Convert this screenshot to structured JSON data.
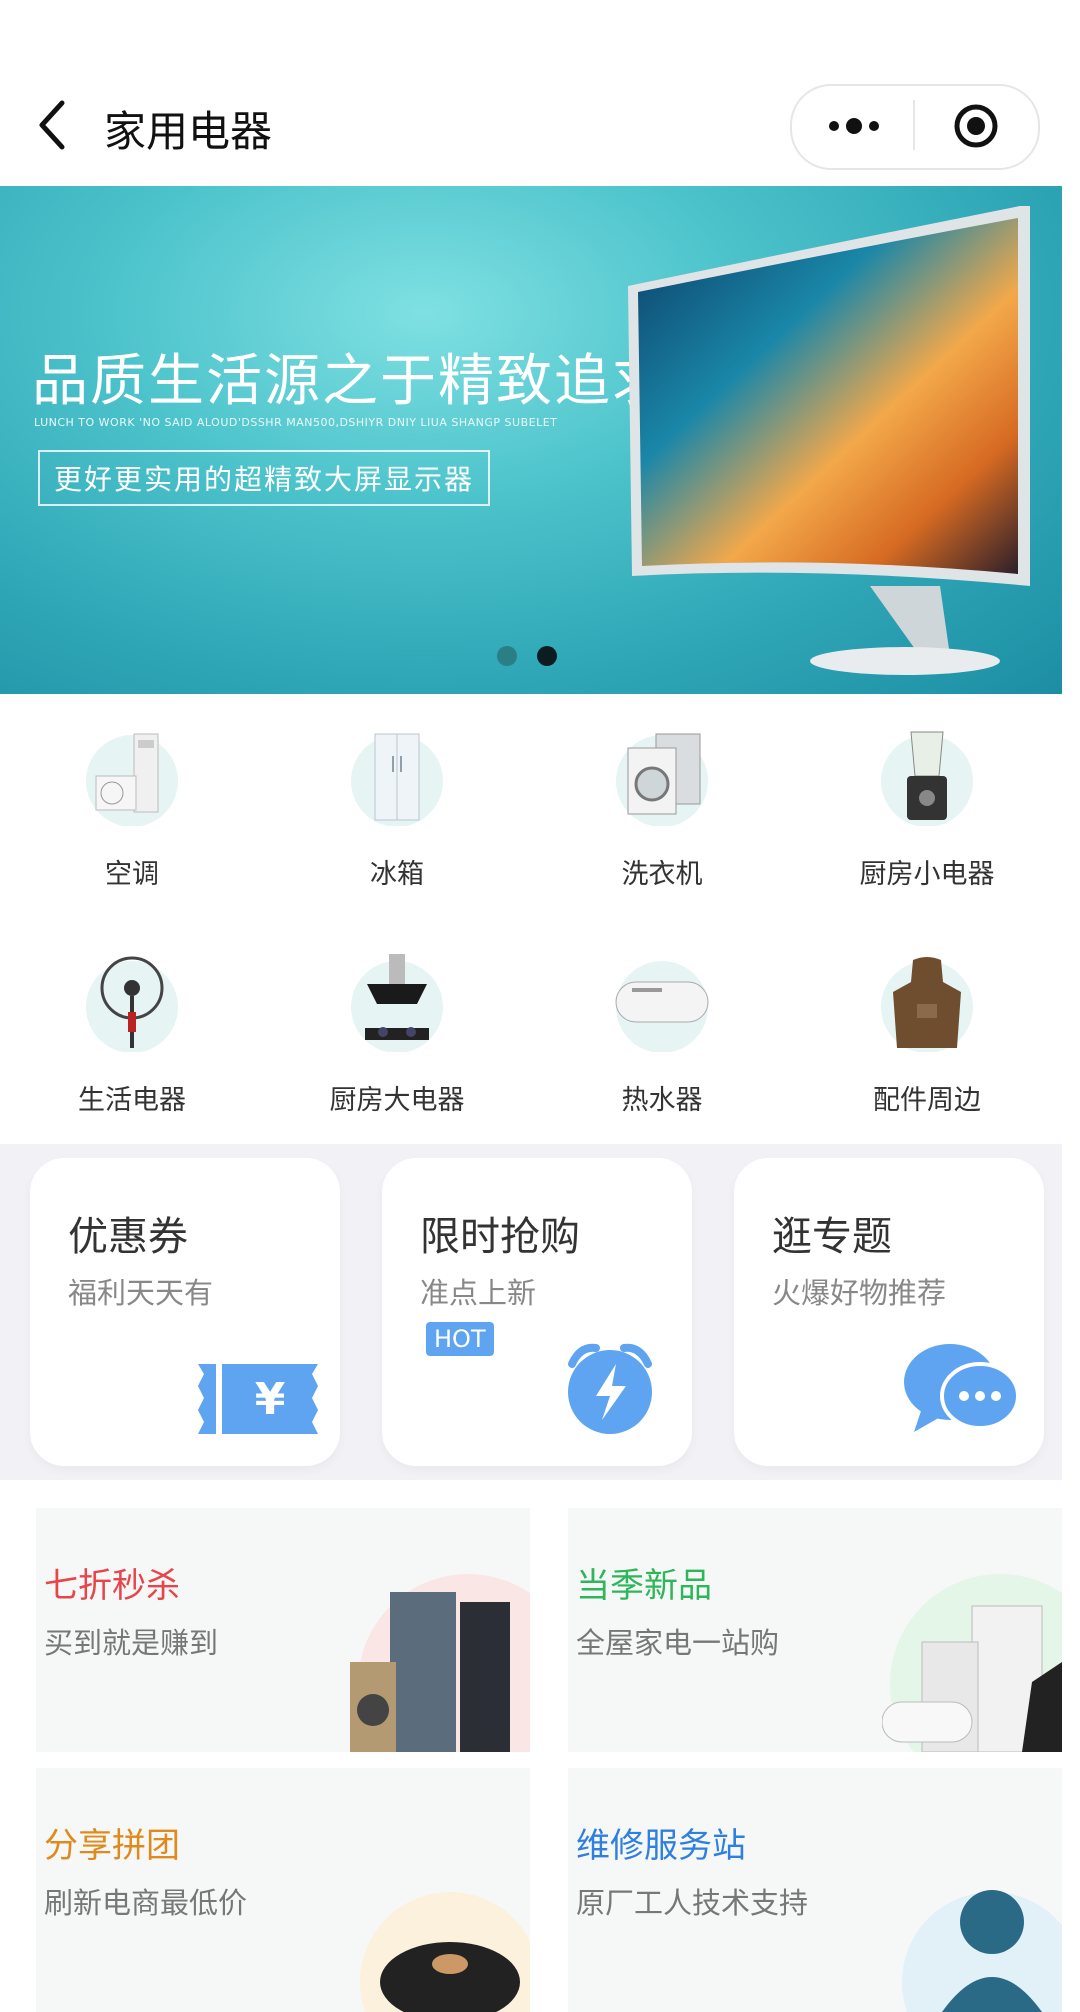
{
  "header": {
    "title": "家用电器",
    "back_icon": "chevron-left-icon",
    "more_icon": "more-dots-icon",
    "close_icon": "target-icon"
  },
  "banner": {
    "heading": "品质生活源之于精致追求",
    "subline": "LUNCH TO WORK 'NO SAID ALOUD'DSSHR MAN500,DSHIYR DNIY LIUA SHANGP SUBELET",
    "tagline": "更好更实用的超精致大屏显示器",
    "pager": {
      "total": 2,
      "active": 2
    },
    "colors": {
      "bg": "#39b3bf",
      "text": "#ffffff"
    }
  },
  "categories": [
    {
      "label": "空调",
      "icon": "air-conditioner-icon"
    },
    {
      "label": "冰箱",
      "icon": "refrigerator-icon"
    },
    {
      "label": "洗衣机",
      "icon": "washing-machine-icon"
    },
    {
      "label": "厨房小电器",
      "icon": "blender-icon"
    },
    {
      "label": "生活电器",
      "icon": "fan-icon"
    },
    {
      "label": "厨房大电器",
      "icon": "range-hood-icon"
    },
    {
      "label": "热水器",
      "icon": "water-heater-icon"
    },
    {
      "label": "配件周边",
      "icon": "apron-icon"
    }
  ],
  "promos": [
    {
      "title": "优惠券",
      "subtitle": "福利天天有",
      "icon": "coupon-yen-icon"
    },
    {
      "title": "限时抢购",
      "subtitle": "准点上新",
      "badge": "HOT",
      "icon": "alarm-clock-bolt-icon"
    },
    {
      "title": "逛专题",
      "subtitle": "火爆好物推荐",
      "icon": "chat-bubbles-icon"
    }
  ],
  "features": [
    {
      "title": "七折秒杀",
      "subtitle": "买到就是赚到",
      "color": "#e8454a",
      "icon": "fridge-washer-icon"
    },
    {
      "title": "当季新品",
      "subtitle": "全屋家电一站购",
      "color": "#2fb55a",
      "icon": "water-heater-set-icon"
    },
    {
      "title": "分享拼团",
      "subtitle": "刷新电商最低价",
      "color": "#e08a1c",
      "icon": "rice-cooker-icon"
    },
    {
      "title": "维修服务站",
      "subtitle": "原厂工人技术支持",
      "color": "#2f7fe0",
      "icon": "technician-icon"
    }
  ],
  "accent": "#5fa4f1"
}
